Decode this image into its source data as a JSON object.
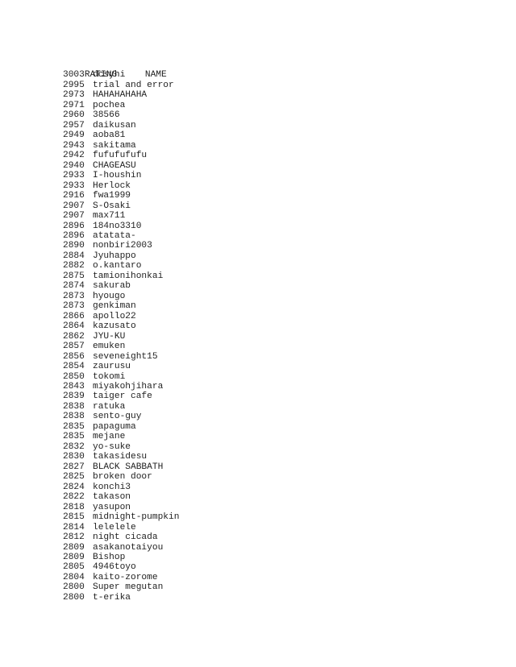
{
  "header": {
    "rating_label": "RATING",
    "name_label": "NAME"
  },
  "rows": [
    {
      "rating": "3003",
      "name": "dcsyhi"
    },
    {
      "rating": "2995",
      "name": "trial and error"
    },
    {
      "rating": "2973",
      "name": "HAHAHAHAHA"
    },
    {
      "rating": "2971",
      "name": "pochea"
    },
    {
      "rating": "2960",
      "name": "38566"
    },
    {
      "rating": "2957",
      "name": "daikusan"
    },
    {
      "rating": "2949",
      "name": "aoba81"
    },
    {
      "rating": "2943",
      "name": "sakitama"
    },
    {
      "rating": "2942",
      "name": "fufufufufu"
    },
    {
      "rating": "2940",
      "name": "CHAGEASU"
    },
    {
      "rating": "2933",
      "name": "I-houshin"
    },
    {
      "rating": "2933",
      "name": "Herlock"
    },
    {
      "rating": "2916",
      "name": "fwa1999"
    },
    {
      "rating": "2907",
      "name": "S-Osaki"
    },
    {
      "rating": "2907",
      "name": "max711"
    },
    {
      "rating": "2896",
      "name": "184no3310"
    },
    {
      "rating": "2896",
      "name": "atatata-"
    },
    {
      "rating": "2890",
      "name": "nonbiri2003"
    },
    {
      "rating": "2884",
      "name": "Jyuhappo"
    },
    {
      "rating": "2882",
      "name": "o.kantaro"
    },
    {
      "rating": "2875",
      "name": "tamionihonkai"
    },
    {
      "rating": "2874",
      "name": "sakurab"
    },
    {
      "rating": "2873",
      "name": "hyougo"
    },
    {
      "rating": "2873",
      "name": "genkiman"
    },
    {
      "rating": "2866",
      "name": "apollo22"
    },
    {
      "rating": "2864",
      "name": "kazusato"
    },
    {
      "rating": "2862",
      "name": "JYU-KU"
    },
    {
      "rating": "2857",
      "name": "emuken"
    },
    {
      "rating": "2856",
      "name": "seveneight15"
    },
    {
      "rating": "2854",
      "name": "zaurusu"
    },
    {
      "rating": "2850",
      "name": "tokomi"
    },
    {
      "rating": "2843",
      "name": "miyakohjihara"
    },
    {
      "rating": "2839",
      "name": "taiger cafe"
    },
    {
      "rating": "2838",
      "name": "ratuka"
    },
    {
      "rating": "2838",
      "name": "sento-guy"
    },
    {
      "rating": "2835",
      "name": "papaguma"
    },
    {
      "rating": "2835",
      "name": "mejane"
    },
    {
      "rating": "2832",
      "name": "yo-suke"
    },
    {
      "rating": "2830",
      "name": "takasidesu"
    },
    {
      "rating": "2827",
      "name": "BLACK SABBATH"
    },
    {
      "rating": "2825",
      "name": "broken door"
    },
    {
      "rating": "2824",
      "name": "konchi3"
    },
    {
      "rating": "2822",
      "name": "takason"
    },
    {
      "rating": "2818",
      "name": "yasupon"
    },
    {
      "rating": "2815",
      "name": "midnight-pumpkin"
    },
    {
      "rating": "2814",
      "name": "lelelele"
    },
    {
      "rating": "2812",
      "name": "night cicada"
    },
    {
      "rating": "2809",
      "name": "asakanotaiyou"
    },
    {
      "rating": "2809",
      "name": "Bishop"
    },
    {
      "rating": "2805",
      "name": "4946toyo"
    },
    {
      "rating": "2804",
      "name": "kaito-zorome"
    },
    {
      "rating": "2800",
      "name": "Super megutan"
    },
    {
      "rating": "2800",
      "name": "t-erika"
    }
  ]
}
